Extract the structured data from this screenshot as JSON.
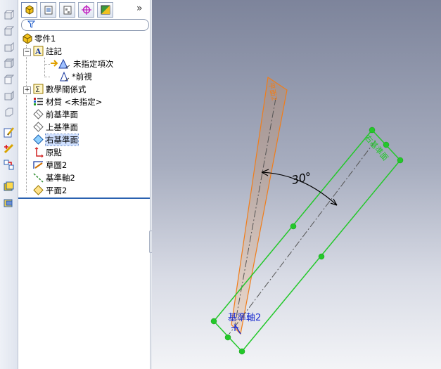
{
  "left_toolbar": {
    "icons": [
      "standard-view-icon",
      "front-view-icon",
      "back-view-icon",
      "left-view-icon",
      "right-view-icon",
      "top-view-icon",
      "bottom-view-icon",
      "sketch-icon",
      "smart-dimension-icon",
      "relation-icon",
      "extrude-icon",
      "cut-extrude-icon"
    ]
  },
  "feature_manager": {
    "tabs": [
      "feature-manager-tab",
      "property-manager-tab",
      "configuration-manager-tab",
      "dimxpert-tab",
      "display-manager-tab"
    ],
    "more_tabs": "»",
    "filter_placeholder": "",
    "tree": {
      "root": "零件1",
      "annotations": "註記",
      "unassigned_items": "未指定項次",
      "front_view": "*前視",
      "equations": "數學關係式",
      "material": "材質 <未指定>",
      "front_plane": "前基準面",
      "top_plane": "上基準面",
      "right_plane": "右基準面",
      "origin": "原點",
      "sketch2": "草圖2",
      "axis2": "基準軸2",
      "plane2": "平面2"
    }
  },
  "graphics": {
    "angle_label": "30°",
    "axis_label": "基準軸2",
    "orange_plane_label": "平面2",
    "green_plane_label": "右基準面",
    "colors": {
      "orange": "#f07d1a",
      "green": "#23c82a",
      "blue": "#1e2fd0",
      "selection": "#cfe0ff",
      "accent": "#2a61b0"
    }
  }
}
